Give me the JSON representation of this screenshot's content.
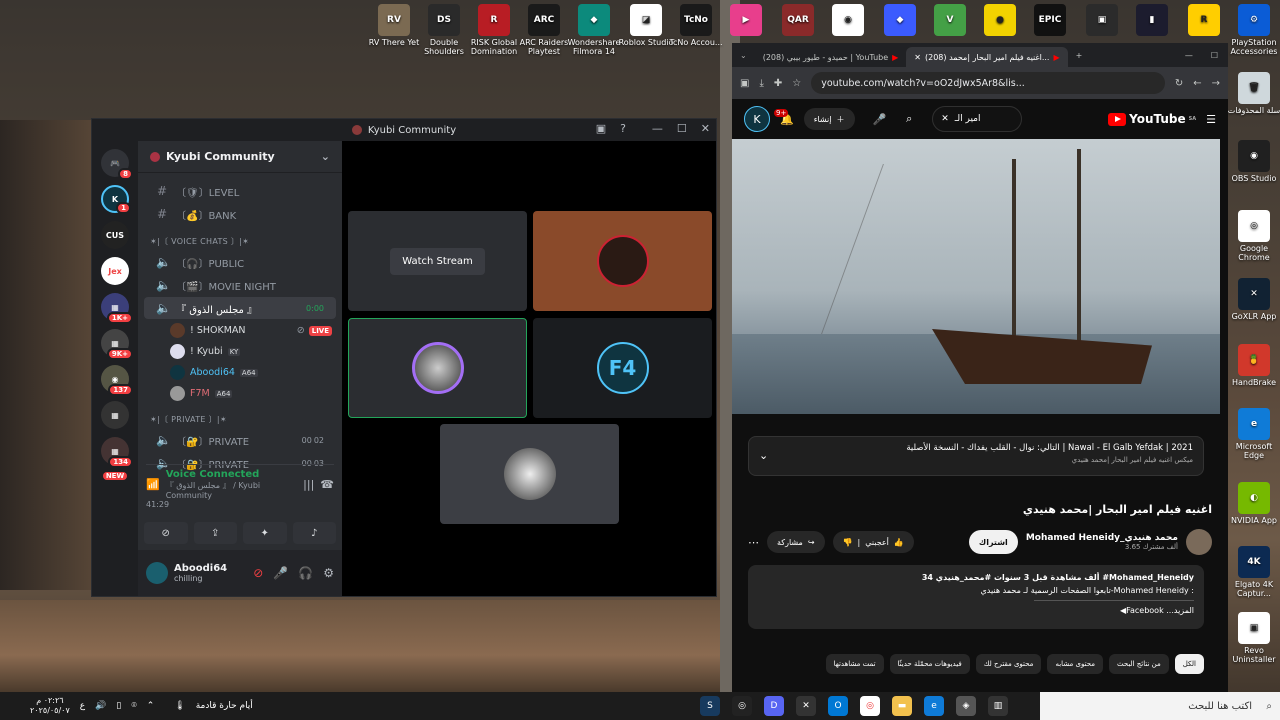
{
  "desktop_top_icons": [
    {
      "label": "RV There Yet",
      "color": "#7b6a52",
      "glyph": "RV"
    },
    {
      "label": "Double Shoulders",
      "color": "#2a2a2a",
      "glyph": "DS"
    },
    {
      "label": "RISK Global Domination",
      "color": "#b81d24",
      "glyph": "R"
    },
    {
      "label": "ARC Raiders Playtest",
      "color": "#1a1a1a",
      "glyph": "ARC"
    },
    {
      "label": "Wondershare Filmora 14",
      "color": "#0c8a7c",
      "glyph": "◆"
    },
    {
      "label": "Roblox Studio",
      "color": "#ffffff",
      "glyph": "◪"
    },
    {
      "label": "TcNo Accou...",
      "color": "#1a1a1a",
      "glyph": "TcNo"
    },
    {
      "label": "",
      "color": "#e83e8c",
      "glyph": "▶"
    },
    {
      "label": "",
      "color": "#8a2a2a",
      "glyph": "QAR"
    },
    {
      "label": "",
      "color": "#ffffff",
      "glyph": "◉"
    },
    {
      "label": "",
      "color": "#3b5bfe",
      "glyph": "◆"
    },
    {
      "label": "",
      "color": "#44a046",
      "glyph": "V"
    },
    {
      "label": "",
      "color": "#f2d200",
      "glyph": "●"
    },
    {
      "label": "",
      "color": "#111111",
      "glyph": "EPIC"
    },
    {
      "label": "",
      "color": "#2b2b2b",
      "glyph": "▣"
    },
    {
      "label": "",
      "color": "#1c1c2e",
      "glyph": "▮"
    },
    {
      "label": "",
      "color": "#ffce00",
      "glyph": "R"
    },
    {
      "label": "PlayStation Accessories",
      "color": "#0b5cd6",
      "glyph": "⚙"
    }
  ],
  "desktop_right_icons": [
    {
      "label": "سلة المحذوفات",
      "color": "#cfd8dc",
      "glyph": "🗑"
    },
    {
      "label": "OBS Studio",
      "color": "#202020",
      "glyph": "◉"
    },
    {
      "label": "Google Chrome",
      "color": "#ffffff",
      "glyph": "◎"
    },
    {
      "label": "GoXLR App",
      "color": "#123",
      "glyph": "✕"
    },
    {
      "label": "HandBrake",
      "color": "#d1382b",
      "glyph": "🍍"
    },
    {
      "label": "Microsoft Edge",
      "color": "#0f7bd7",
      "glyph": "e"
    },
    {
      "label": "NVIDIA App",
      "color": "#76b900",
      "glyph": "◐"
    },
    {
      "label": "Elgato 4K Captur...",
      "color": "#0c2a52",
      "glyph": "4K"
    },
    {
      "label": "Revo Uninstaller",
      "color": "#ffffff",
      "glyph": "▣"
    }
  ],
  "discord": {
    "title": "Kyubi Community",
    "server_name": "Kyubi Community",
    "guild_badges": [
      "8",
      "1",
      "1K+",
      "9K+",
      "137",
      "134",
      "NEW"
    ],
    "channels": [
      {
        "sym": "#",
        "label": "〔🛡〕LEVEL"
      },
      {
        "sym": "#",
        "label": "〔💰〕BANK"
      }
    ],
    "voice_category": "✶|〔 VOICE CHATS 〕|✶",
    "voice_channels": [
      {
        "label": "〔🎧〕PUBLIC"
      },
      {
        "label": "〔🎬〕MOVIE NIGHT"
      },
      {
        "label": "『 مجلس الذوق 』",
        "time": "0:00"
      }
    ],
    "voice_users": [
      {
        "name": "! SHOKMAN",
        "live": "LIVE",
        "color": "#f2f3f5"
      },
      {
        "name": "! Kyubi",
        "tag": "KY",
        "color": "#f2f3f5"
      },
      {
        "name": "Aboodi64",
        "tag": "A64",
        "color": "#4fc3f7"
      },
      {
        "name": "F7M",
        "tag": "A64",
        "color": "#e06c75"
      }
    ],
    "private_category": "✶|〔 PRIVATE 〕|✶",
    "private_channels": [
      {
        "label": "〔🔐〕PRIVATE",
        "a": "00",
        "b": "02"
      },
      {
        "label": "〔🔐〕PRIVATE",
        "a": "00",
        "b": "03"
      }
    ],
    "voice_connected": "Voice Connected",
    "voice_sub": "『 مجلس الذوق 』 / Kyubi Community",
    "voice_time": "41:29",
    "user": {
      "name": "Aboodi64",
      "status": "chilling"
    },
    "watch_stream": "Watch Stream"
  },
  "browser": {
    "tabs": [
      {
        "label": "(208) اغنيه فيلم امير البحار |محمد..."
      },
      {
        "label": "(208) حميدو - طيور بيبي | YouTube"
      }
    ],
    "url": "youtube.com/watch?v=oO2dJwx5Ar8&lis...",
    "yt_logo": "YouTube",
    "yt_region": "SA",
    "search_value": "امير الـ",
    "create_label": "إنشاء",
    "notif_badge": "9+",
    "next_label": "التالي: نوال - القلب يفداك - النسخة الأصلية | Nawal - El Galb Yefdak | 2021",
    "next_sub": "ميكس اغنيه فيلم امير البحار |محمد هنيدي",
    "video_title": "اغنيه فيلم امير البحار |محمد هنيدي",
    "channel_name": "Mohamed Heneidy_محمد هنيدي",
    "subs": "3.65 ألف مشترك",
    "subscribe": "اشتراك",
    "like": "أعجبني",
    "share": "مشاركة",
    "desc_line1": "34 ألف مشاهدة قبل 3 سنوات #محمد_هنيدي #Mohamed_Heneidy",
    "desc_line2": "تابعوا الصفحات الرسمية لـ محمد هنيدي-Mohamed Heneidy :",
    "desc_line3": "◀Facebook ...المزيد",
    "chips": [
      "الكل",
      "من نتائج البحث",
      "محتوى مشابه",
      "محتوى مقترح لك",
      "فيديوهات محمّلة حديثًا",
      "تمت مشاهدتها"
    ]
  },
  "taskbar": {
    "search_placeholder": "اكتب هنا للبحث",
    "weather": "أيام حارة قادمة",
    "time": "٠٢:٢٦ م",
    "date": "٢٠٢٥/٠٥/٠٧",
    "lang": "ع"
  }
}
